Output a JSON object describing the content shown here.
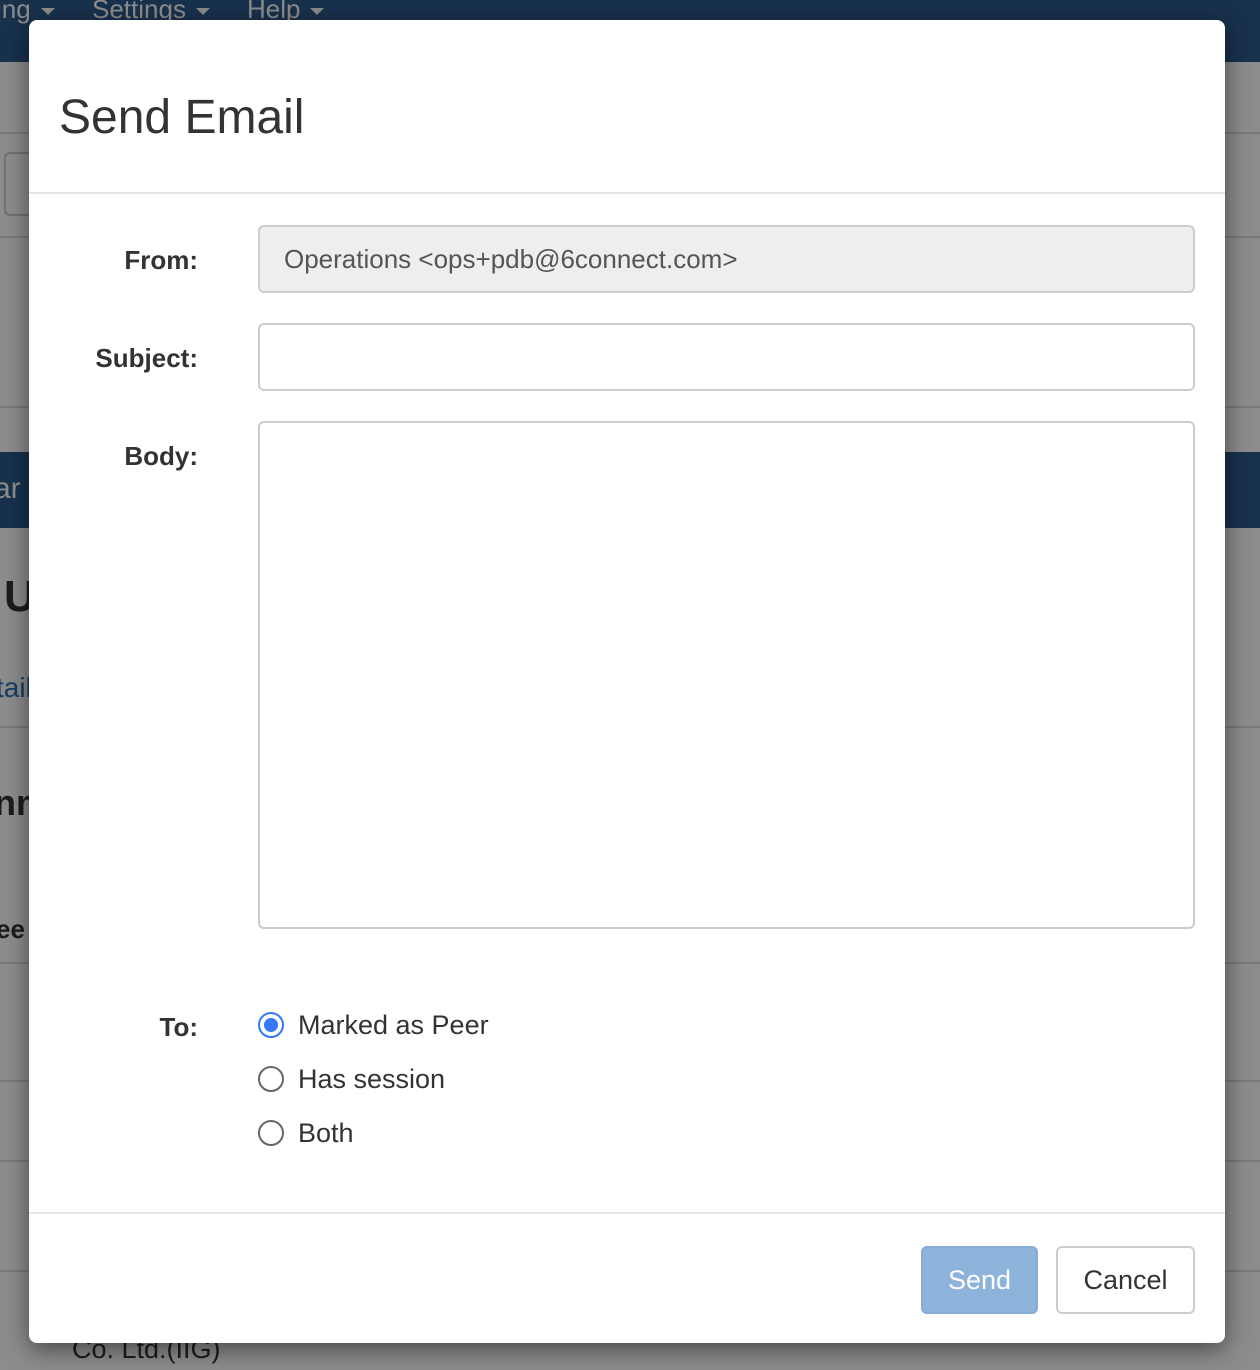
{
  "background": {
    "nav_items": [
      "ing",
      "Settings",
      "Help"
    ],
    "fragments": {
      "band_text": "ar",
      "heading_u": "U",
      "link_tail": "tail",
      "heading_nm": "nm",
      "label_ee": "ee",
      "footer_company": "Co. Ltd.(IIG)"
    }
  },
  "modal": {
    "title": "Send Email",
    "from": {
      "label": "From:",
      "value": "Operations <ops+pdb@6connect.com>"
    },
    "subject": {
      "label": "Subject:",
      "value": ""
    },
    "body": {
      "label": "Body:",
      "value": ""
    },
    "to": {
      "label": "To:",
      "options": [
        {
          "label": "Marked as Peer",
          "checked": true
        },
        {
          "label": "Has session",
          "checked": false
        },
        {
          "label": "Both",
          "checked": false
        }
      ]
    },
    "buttons": {
      "send": "Send",
      "cancel": "Cancel"
    }
  },
  "colors": {
    "primary_disabled": "#8eb3db",
    "radio_accent": "#3478f6",
    "nav": "#2c5a8c"
  }
}
